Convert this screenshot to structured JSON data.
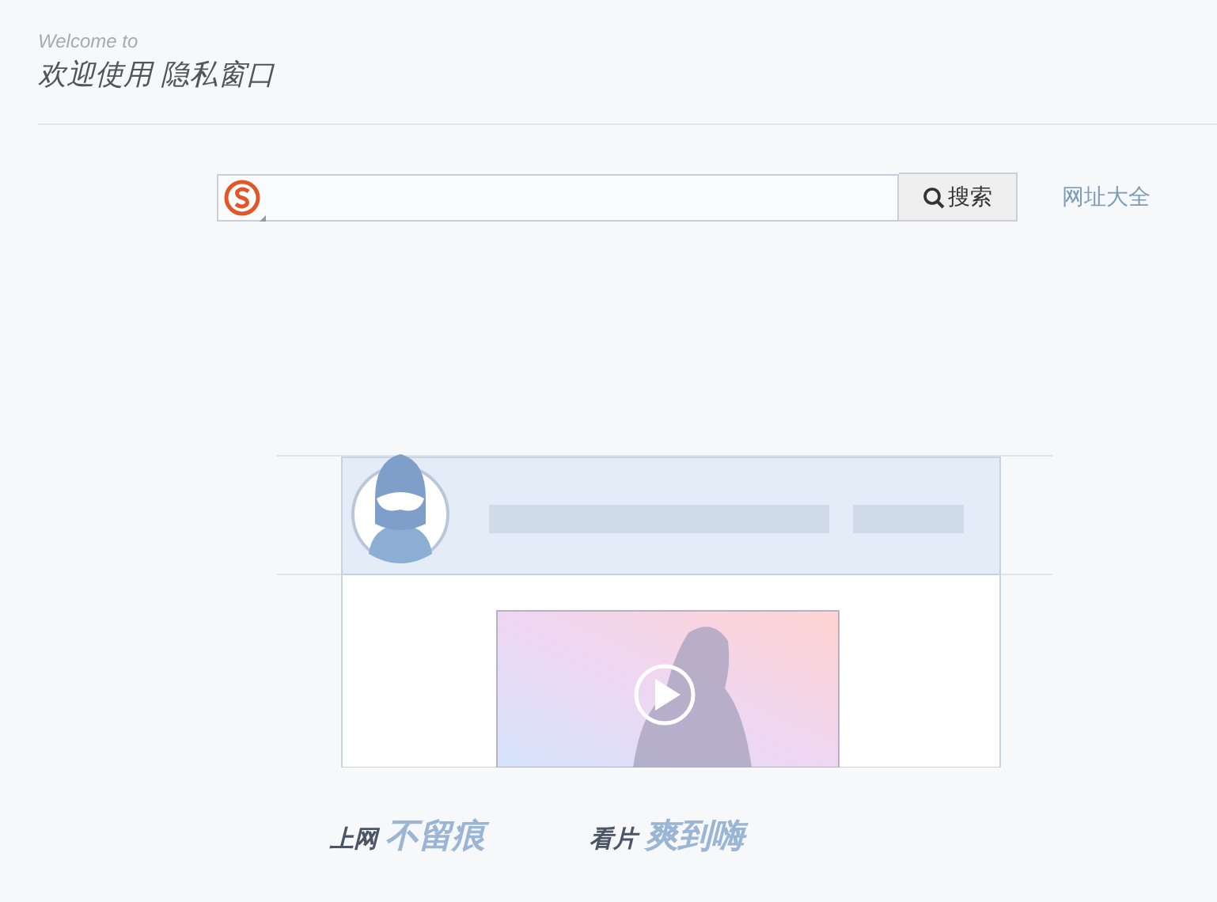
{
  "header": {
    "subtitle": "Welcome to",
    "title": "欢迎使用 隐私窗口"
  },
  "search": {
    "button": "搜索",
    "link": "网址大全"
  },
  "slogans": [
    {
      "lead": "上网",
      "accent": "不留痕"
    },
    {
      "lead": "看片",
      "accent": "爽到嗨"
    }
  ]
}
